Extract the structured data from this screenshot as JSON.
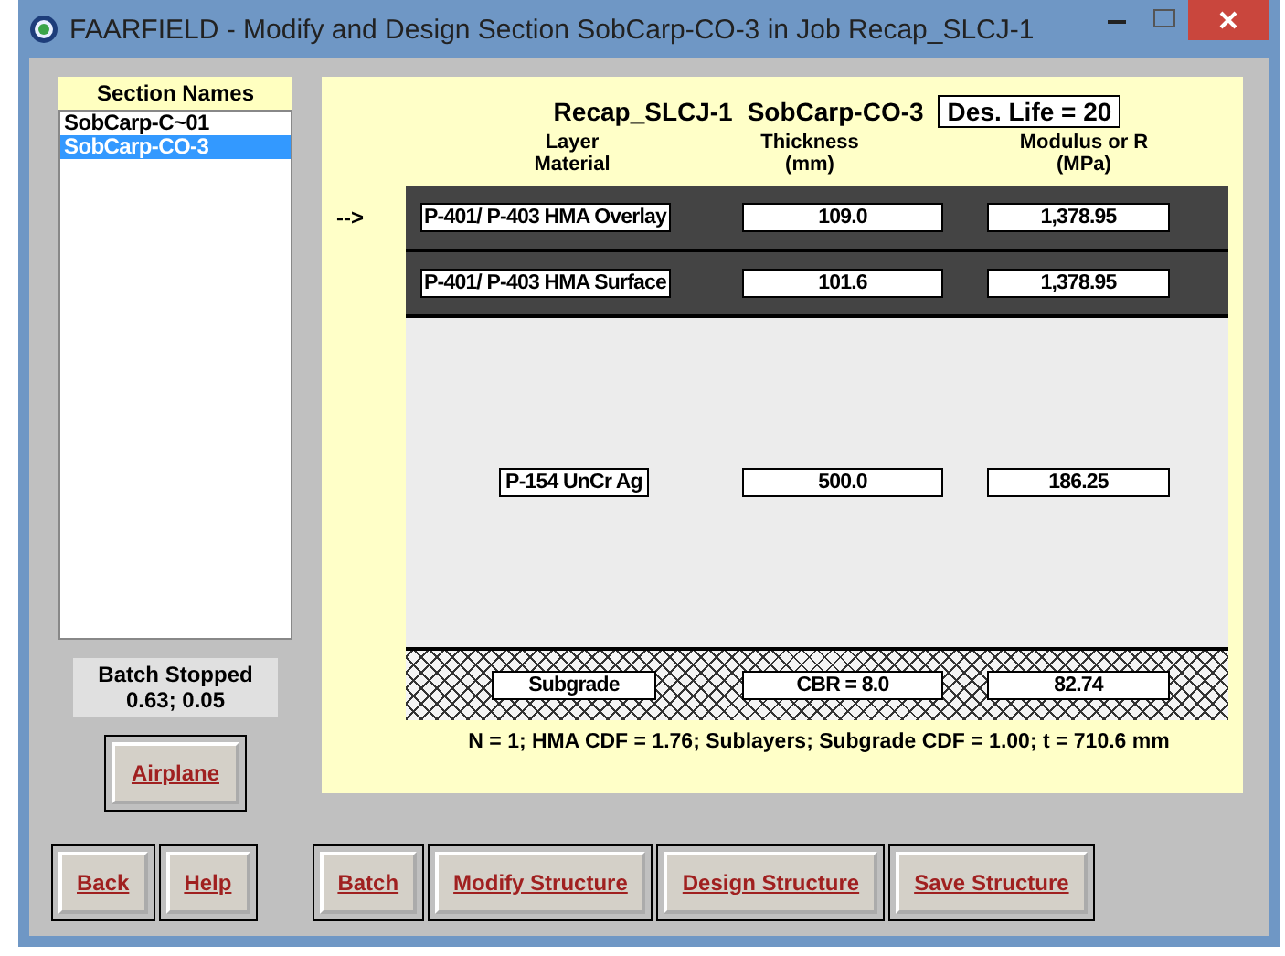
{
  "window": {
    "title": "FAARFIELD - Modify and Design Section SobCarp-CO-3 in Job Recap_SLCJ-1"
  },
  "sections": {
    "title": "Section Names",
    "items": [
      {
        "label": "SobCarp-C~01",
        "selected": false
      },
      {
        "label": "SobCarp-CO-3",
        "selected": true
      }
    ]
  },
  "batch_status": {
    "title": "Batch Stopped",
    "values": "0.63;  0.05"
  },
  "airplane_button": "Airplane",
  "structure": {
    "job": "Recap_SLCJ-1",
    "section": "SobCarp-CO-3",
    "design_life": "Des. Life = 20",
    "columns": [
      "Layer\nMaterial",
      "Thickness\n(mm)",
      "Modulus or R\n(MPa)"
    ],
    "pointer": "-->",
    "layers": [
      {
        "kind": "dark",
        "material": "P-401/ P-403 HMA Overlay",
        "thickness": "109.0",
        "modulus": "1,378.95",
        "selected": true
      },
      {
        "kind": "dark",
        "material": "P-401/ P-403 HMA Surface",
        "thickness": "101.6",
        "modulus": "1,378.95",
        "selected": false
      },
      {
        "kind": "light",
        "material": "P-154 UnCr Ag",
        "thickness": "500.0",
        "modulus": "186.25",
        "selected": false
      },
      {
        "kind": "subgrade",
        "material": "Subgrade",
        "thickness": "CBR = 8.0",
        "modulus": "82.74",
        "selected": false
      }
    ],
    "summary": "N = 1;  HMA CDF = 1.76;  Sublayers;  Subgrade CDF = 1.00;  t = 710.6 mm"
  },
  "buttons": [
    "Back",
    "Help",
    "Batch",
    "Modify Structure",
    "Design Structure",
    "Save Structure"
  ]
}
